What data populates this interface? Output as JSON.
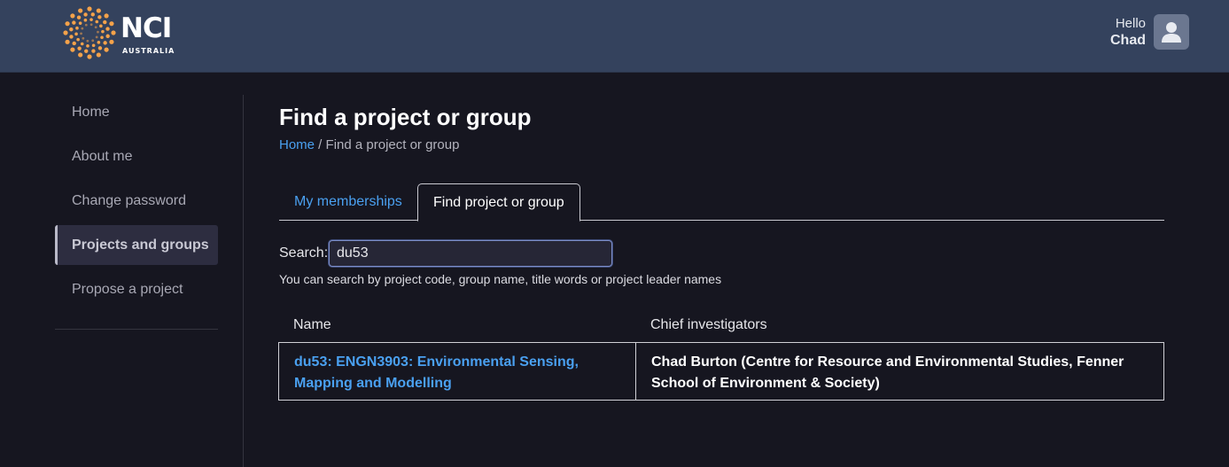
{
  "brand": {
    "name": "NCI",
    "subtitle": "AUSTRALIA",
    "dot_color": "#f5a24a"
  },
  "user": {
    "greeting": "Hello",
    "name": "Chad",
    "avatar_icon": "user-icon"
  },
  "sidebar": {
    "items": [
      {
        "label": "Home",
        "active": false
      },
      {
        "label": "About me",
        "active": false
      },
      {
        "label": "Change password",
        "active": false
      },
      {
        "label": "Projects and groups",
        "active": true
      },
      {
        "label": "Propose a project",
        "active": false
      }
    ]
  },
  "page": {
    "title": "Find a project or group",
    "breadcrumb_home": "Home",
    "breadcrumb_sep": " / ",
    "breadcrumb_current": "Find a project or group"
  },
  "tabs": [
    {
      "label": "My memberships",
      "active": false
    },
    {
      "label": "Find project or group",
      "active": true
    }
  ],
  "search": {
    "label": "Search:",
    "value": "du53",
    "hint": "You can search by project code, group name, title words or project leader names"
  },
  "results": {
    "columns": [
      "Name",
      "Chief investigators"
    ],
    "rows": [
      {
        "name": "du53: ENGN3903: Environmental Sensing, Mapping and Modelling",
        "chief_investigators": "Chad Burton (Centre for Resource and Environmental Studies, Fenner School of Environment & Society)"
      }
    ]
  },
  "colors": {
    "header_bg": "#34425d",
    "page_bg": "#161620",
    "link": "#4aa0f0"
  }
}
